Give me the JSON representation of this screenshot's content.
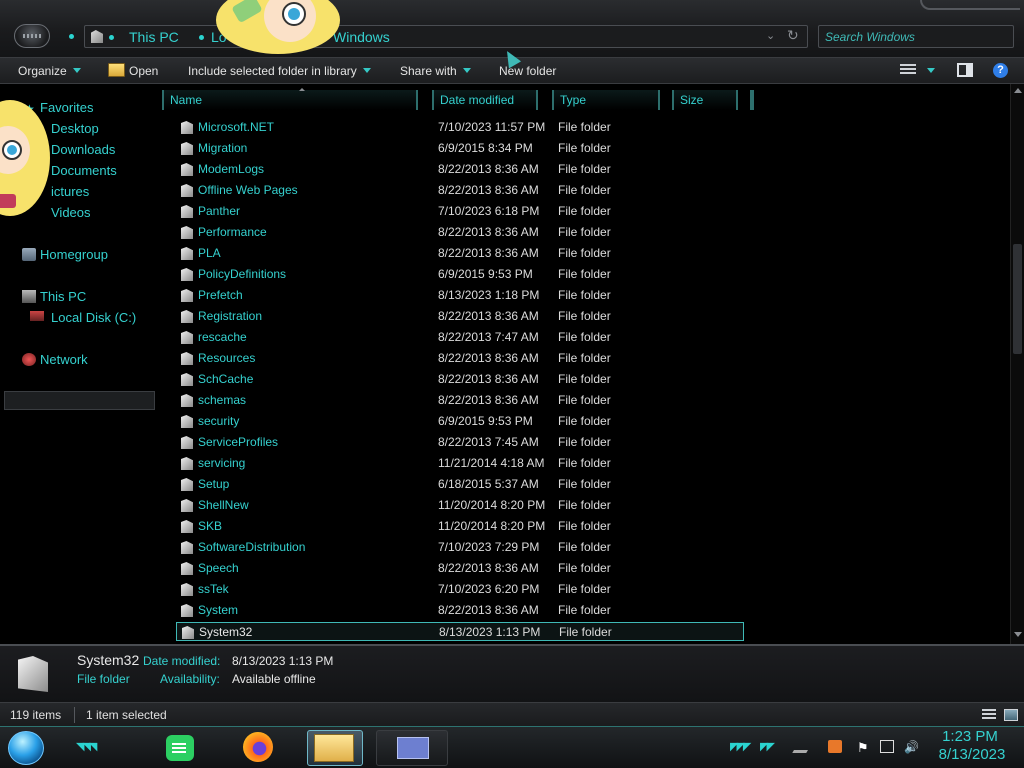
{
  "address": {
    "crumbs": [
      "This PC",
      "Lo",
      "Windows"
    ],
    "search_placeholder": "Search Windows"
  },
  "toolbar": {
    "organize": "Organize",
    "open": "Open",
    "include_library": "Include selected folder in library",
    "share_with": "Share with",
    "new_folder": "New folder"
  },
  "nav": {
    "favorites": "Favorites",
    "desktop": "Desktop",
    "downloads": "Downloads",
    "documents": "Documents",
    "pictures": "ictures",
    "videos": "Videos",
    "homegroup": "Homegroup",
    "this_pc": "This PC",
    "local_disk": "Local Disk (C:)",
    "network": "Network"
  },
  "columns": {
    "name": "Name",
    "date_modified": "Date modified",
    "type": "Type",
    "size": "Size"
  },
  "files": [
    {
      "name": "Microsoft.NET",
      "date": "7/10/2023 11:57 PM",
      "type": "File folder"
    },
    {
      "name": "Migration",
      "date": "6/9/2015 8:34 PM",
      "type": "File folder"
    },
    {
      "name": "ModemLogs",
      "date": "8/22/2013 8:36 AM",
      "type": "File folder"
    },
    {
      "name": "Offline Web Pages",
      "date": "8/22/2013 8:36 AM",
      "type": "File folder"
    },
    {
      "name": "Panther",
      "date": "7/10/2023 6:18 PM",
      "type": "File folder"
    },
    {
      "name": "Performance",
      "date": "8/22/2013 8:36 AM",
      "type": "File folder"
    },
    {
      "name": "PLA",
      "date": "8/22/2013 8:36 AM",
      "type": "File folder"
    },
    {
      "name": "PolicyDefinitions",
      "date": "6/9/2015 9:53 PM",
      "type": "File folder"
    },
    {
      "name": "Prefetch",
      "date": "8/13/2023 1:18 PM",
      "type": "File folder"
    },
    {
      "name": "Registration",
      "date": "8/22/2013 8:36 AM",
      "type": "File folder"
    },
    {
      "name": "rescache",
      "date": "8/22/2013 7:47 AM",
      "type": "File folder"
    },
    {
      "name": "Resources",
      "date": "8/22/2013 8:36 AM",
      "type": "File folder"
    },
    {
      "name": "SchCache",
      "date": "8/22/2013 8:36 AM",
      "type": "File folder"
    },
    {
      "name": "schemas",
      "date": "8/22/2013 8:36 AM",
      "type": "File folder"
    },
    {
      "name": "security",
      "date": "6/9/2015 9:53 PM",
      "type": "File folder"
    },
    {
      "name": "ServiceProfiles",
      "date": "8/22/2013 7:45 AM",
      "type": "File folder"
    },
    {
      "name": "servicing",
      "date": "11/21/2014 4:18 AM",
      "type": "File folder"
    },
    {
      "name": "Setup",
      "date": "6/18/2015 5:37 AM",
      "type": "File folder"
    },
    {
      "name": "ShellNew",
      "date": "11/20/2014 8:20 PM",
      "type": "File folder"
    },
    {
      "name": "SKB",
      "date": "11/20/2014 8:20 PM",
      "type": "File folder"
    },
    {
      "name": "SoftwareDistribution",
      "date": "7/10/2023 7:29 PM",
      "type": "File folder"
    },
    {
      "name": "Speech",
      "date": "8/22/2013 8:36 AM",
      "type": "File folder"
    },
    {
      "name": "ssTek",
      "date": "7/10/2023 6:20 PM",
      "type": "File folder"
    },
    {
      "name": "System",
      "date": "8/22/2013 8:36 AM",
      "type": "File folder"
    },
    {
      "name": "System32",
      "date": "8/13/2023 1:13 PM",
      "type": "File folder"
    }
  ],
  "details": {
    "name": "System32",
    "date_label": "Date modified:",
    "date_value": "8/13/2023 1:13 PM",
    "type": "File folder",
    "availability_label": "Availability:",
    "availability_value": "Available offline"
  },
  "status": {
    "item_count": "119 items",
    "selected": "1 item selected"
  },
  "clock": {
    "time": "1:23 PM",
    "date": "8/13/2023"
  },
  "colors": {
    "accent": "#35d1cf",
    "background": "#000000",
    "text": "#dcdcdc"
  }
}
